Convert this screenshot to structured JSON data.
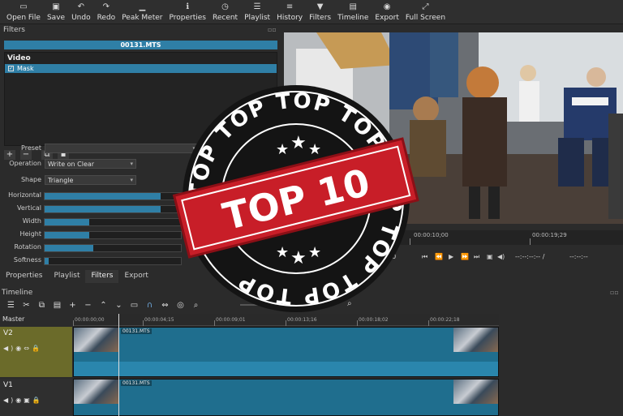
{
  "toolbar": {
    "items": [
      {
        "label": "Open File",
        "icon": "folder-open-icon",
        "glyph": "▭"
      },
      {
        "label": "Save",
        "icon": "save-icon",
        "glyph": "▣"
      },
      {
        "label": "Undo",
        "icon": "undo-icon",
        "glyph": "↶"
      },
      {
        "label": "Redo",
        "icon": "redo-icon",
        "glyph": "↷"
      },
      {
        "label": "Peak Meter",
        "icon": "peak-meter-icon",
        "glyph": "▁"
      },
      {
        "label": "Properties",
        "icon": "properties-icon",
        "glyph": "ℹ"
      },
      {
        "label": "Recent",
        "icon": "recent-icon",
        "glyph": "◷"
      },
      {
        "label": "Playlist",
        "icon": "playlist-icon",
        "glyph": "☰"
      },
      {
        "label": "History",
        "icon": "history-icon",
        "glyph": "≡"
      },
      {
        "label": "Filters",
        "icon": "filters-icon",
        "glyph": "▼"
      },
      {
        "label": "Timeline",
        "icon": "timeline-icon",
        "glyph": "▤"
      },
      {
        "label": "Export",
        "icon": "export-icon",
        "glyph": "◉"
      },
      {
        "label": "Full Screen",
        "icon": "fullscreen-icon",
        "glyph": "⤢"
      }
    ]
  },
  "filters": {
    "title": "Filters",
    "clip_name": "00131.MTS",
    "section": "Video",
    "items": [
      {
        "label": "Mask",
        "checked": true
      }
    ],
    "preset_label": "Preset",
    "operation_label": "Operation",
    "operation_value": "Write on Clear",
    "shape_label": "Shape",
    "shape_value": "Triangle",
    "params": [
      {
        "label": "Horizontal",
        "fill": 0.85
      },
      {
        "label": "Vertical",
        "fill": 0.85
      },
      {
        "label": "Width",
        "fill": 0.33
      },
      {
        "label": "Height",
        "fill": 0.33
      },
      {
        "label": "Rotation",
        "fill": 0.36
      },
      {
        "label": "Softness",
        "fill": 0.03
      }
    ]
  },
  "tabs": [
    "Properties",
    "Playlist",
    "Filters",
    "Export"
  ],
  "player": {
    "timecode_mid": "00:00:10;00",
    "timecode_end": "00:00:19;29",
    "time_display": "--:--:--:-- /",
    "time_total": "--:--:--"
  },
  "timeline": {
    "title": "Timeline",
    "master_label": "Master",
    "ruler": [
      "00:00:00;00",
      "00:00:04;15",
      "00:00:09;01",
      "00:00:13;16",
      "00:00:18;02",
      "00:00:22;18"
    ],
    "tracks": [
      {
        "name": "V2",
        "clip_label": "00131.MTS"
      },
      {
        "name": "V1",
        "clip_label": "00131.MTS"
      }
    ]
  },
  "badge": {
    "ring_text": "TOP TOP TOP TOP TOP TOP TOP TOP",
    "main_text": "TOP 10",
    "colors": {
      "ribbon": "#c81e28",
      "seal": "#141414",
      "ring": "#ffffff"
    }
  }
}
